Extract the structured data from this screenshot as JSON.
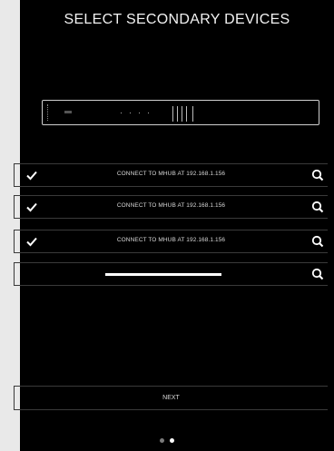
{
  "screen": {
    "title": "SELECT SECONDARY DEVICES"
  },
  "devices": [
    {
      "label": "CONNECT TO MHUB AT 192.168.1.156",
      "checked": true,
      "icon": "search-icon"
    },
    {
      "label": "CONNECT TO MHUB AT 192.168.1.156",
      "checked": true,
      "icon": "search-icon"
    },
    {
      "label": "CONNECT TO MHUB AT 192.168.1.156",
      "checked": true,
      "icon": "search-icon"
    }
  ],
  "empty_slot": {
    "icon": "search-icon"
  },
  "footer": {
    "next_label": "NEXT",
    "page_indicator": {
      "total": 2,
      "current": 2
    }
  },
  "colors": {
    "background": "#000000",
    "text": "#ffffff",
    "border": "#3a3a3a",
    "page_bg": "#e9e9e9"
  }
}
